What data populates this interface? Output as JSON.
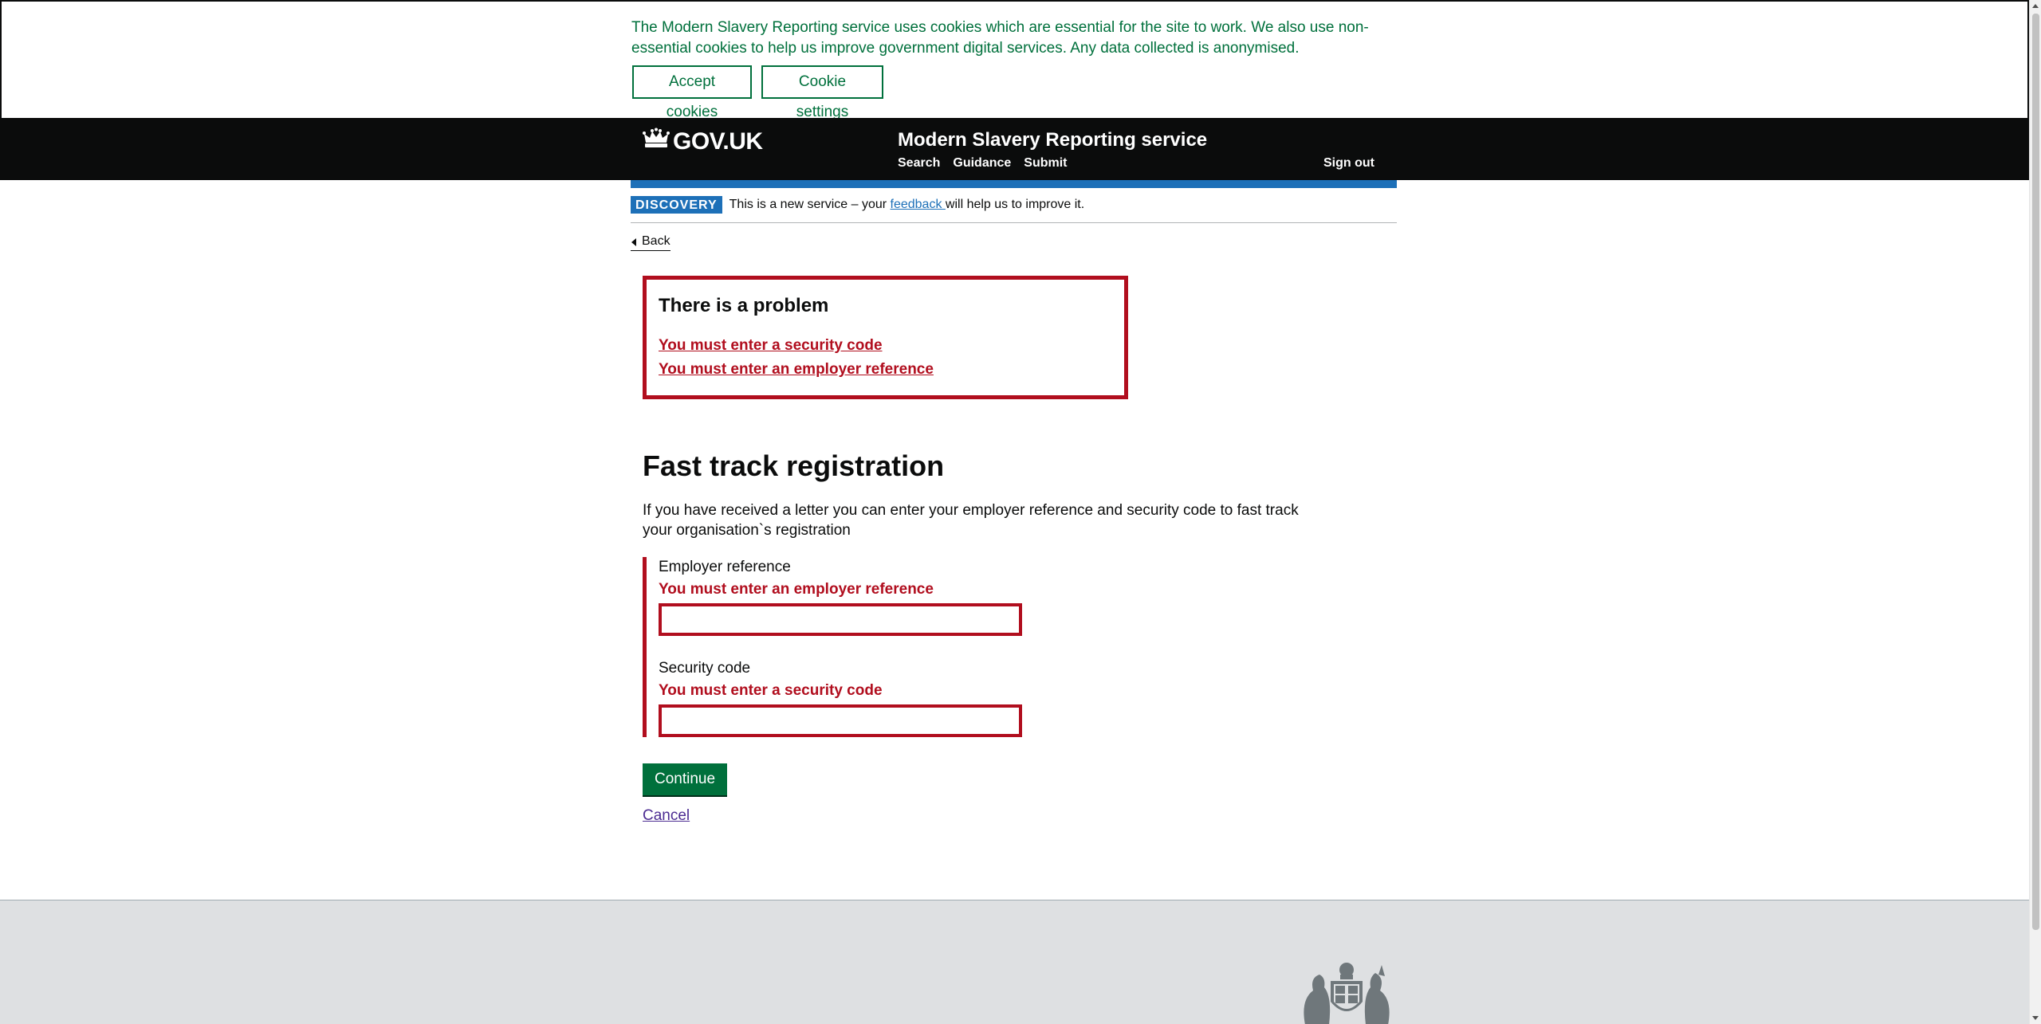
{
  "cookie_banner": {
    "message": "The Modern Slavery Reporting service uses cookies which are essential for the site to work. We also use non-essential cookies to help us improve government digital services. Any data collected is anonymised.",
    "accept_label": "Accept cookies",
    "settings_label": "Cookie settings"
  },
  "header": {
    "logo_text": "GOV.UK",
    "logo_icon": "crown-icon",
    "service_name": "Modern Slavery Reporting service",
    "nav": [
      "Search",
      "Guidance",
      "Submit"
    ],
    "sign_out": "Sign out"
  },
  "phase_banner": {
    "tag": "DISCOVERY",
    "text_before": "This is a new service – your ",
    "link": "feedback ",
    "text_after": "will help us to improve it."
  },
  "back_link": "Back",
  "error_summary": {
    "title": "There is a problem",
    "errors": [
      "You must enter a security code",
      "You must enter an employer reference"
    ]
  },
  "form": {
    "title": "Fast track registration",
    "intro": "If you have received a letter you can enter your employer reference and security code to fast track your organisation`s registration",
    "employer_reference": {
      "label": "Employer reference",
      "error": "You must enter an employer reference",
      "value": ""
    },
    "security_code": {
      "label": "Security code",
      "error": "You must enter a security code",
      "value": ""
    },
    "continue_label": "Continue",
    "cancel_label": "Cancel"
  },
  "colors": {
    "header_bg": "#0b0c0c",
    "brand_blue": "#1d70b8",
    "error_red": "#b10e1e",
    "button_green": "#00703c",
    "footer_bg": "#dee0e2"
  }
}
